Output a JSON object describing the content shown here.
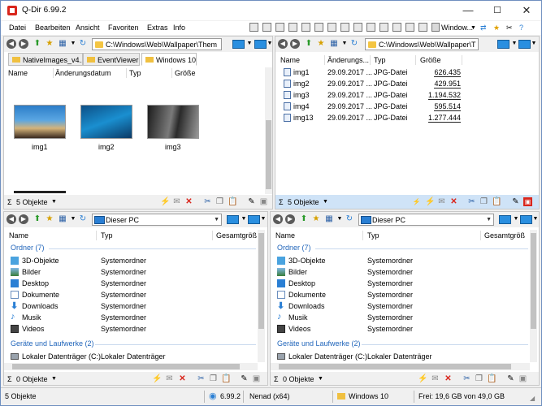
{
  "window": {
    "title": "Q-Dir 6.99.2",
    "minimize": "—",
    "maximize": "☐",
    "close": "✕"
  },
  "menu": [
    "Datei",
    "Bearbeiten",
    "Ansicht",
    "Favoriten",
    "Extras",
    "Info"
  ],
  "right_menu": {
    "window_label": "Window..."
  },
  "pane1": {
    "address": "C:\\Windows\\Web\\Wallpaper\\Them",
    "tabs": [
      "NativeImages_v4...",
      "EventViewer",
      "Windows 10"
    ],
    "columns": [
      "Name",
      "Änderungsdatum",
      "Typ",
      "Größe"
    ],
    "items": [
      "img1",
      "img2",
      "img3"
    ],
    "status": "5 Objekte"
  },
  "pane2": {
    "address": "C:\\Windows\\Web\\Wallpaper\\T",
    "columns": [
      "Name",
      "Änderungs...",
      "Typ",
      "Größe"
    ],
    "rows": [
      {
        "name": "img1",
        "date": "29.09.2017 ...",
        "type": "JPG-Datei",
        "size": "626.435"
      },
      {
        "name": "img2",
        "date": "29.09.2017 ...",
        "type": "JPG-Datei",
        "size": "429.951"
      },
      {
        "name": "img3",
        "date": "29.09.2017 ...",
        "type": "JPG-Datei",
        "size": "1.194.532"
      },
      {
        "name": "img4",
        "date": "29.09.2017 ...",
        "type": "JPG-Datei",
        "size": "595.514"
      },
      {
        "name": "img13",
        "date": "29.09.2017 ...",
        "type": "JPG-Datei",
        "size": "1.277.444"
      }
    ],
    "status": "5 Objekte"
  },
  "pane3": {
    "address": "Dieser PC",
    "columns": [
      "Name",
      "Typ",
      "Gesamtgröß"
    ],
    "group1": "Ordner (7)",
    "folders": [
      {
        "name": "3D-Objekte",
        "type": "Systemordner"
      },
      {
        "name": "Bilder",
        "type": "Systemordner"
      },
      {
        "name": "Desktop",
        "type": "Systemordner"
      },
      {
        "name": "Dokumente",
        "type": "Systemordner"
      },
      {
        "name": "Downloads",
        "type": "Systemordner"
      },
      {
        "name": "Musik",
        "type": "Systemordner"
      },
      {
        "name": "Videos",
        "type": "Systemordner"
      }
    ],
    "group2": "Geräte und Laufwerke (2)",
    "drive": {
      "name": "Lokaler Datenträger (C:)",
      "type": "Lokaler Datenträger"
    },
    "status": "0 Objekte"
  },
  "pane4": {
    "address": "Dieser PC",
    "columns": [
      "Name",
      "Typ",
      "Gesamtgröß"
    ],
    "group1": "Ordner (7)",
    "folders": [
      {
        "name": "3D-Objekte",
        "type": "Systemordner"
      },
      {
        "name": "Bilder",
        "type": "Systemordner"
      },
      {
        "name": "Desktop",
        "type": "Systemordner"
      },
      {
        "name": "Dokumente",
        "type": "Systemordner"
      },
      {
        "name": "Downloads",
        "type": "Systemordner"
      },
      {
        "name": "Musik",
        "type": "Systemordner"
      },
      {
        "name": "Videos",
        "type": "Systemordner"
      }
    ],
    "group2": "Geräte und Laufwerke (2)",
    "drive": {
      "name": "Lokaler Datenträger (C:)",
      "type": "Lokaler Datenträger"
    },
    "status": "0 Objekte"
  },
  "statusbar": {
    "objects": "5 Objekte",
    "version": "6.99.2",
    "user": "Nenad (x64)",
    "folder": "Windows 10",
    "free": "Frei: 19,6 GB von 49,0 GB"
  },
  "sigma": "Σ",
  "colors": {
    "accent": "#d9261c",
    "group": "#2266bb",
    "active_status": "#cfe3f7"
  }
}
